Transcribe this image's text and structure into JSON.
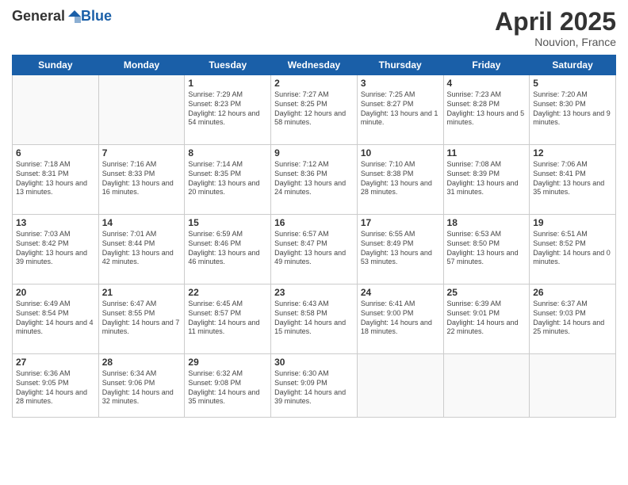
{
  "logo": {
    "general": "General",
    "blue": "Blue"
  },
  "header": {
    "title": "April 2025",
    "subtitle": "Nouvion, France"
  },
  "days": [
    "Sunday",
    "Monday",
    "Tuesday",
    "Wednesday",
    "Thursday",
    "Friday",
    "Saturday"
  ],
  "weeks": [
    [
      {
        "day": "",
        "info": ""
      },
      {
        "day": "",
        "info": ""
      },
      {
        "day": "1",
        "info": "Sunrise: 7:29 AM\nSunset: 8:23 PM\nDaylight: 12 hours and 54 minutes."
      },
      {
        "day": "2",
        "info": "Sunrise: 7:27 AM\nSunset: 8:25 PM\nDaylight: 12 hours and 58 minutes."
      },
      {
        "day": "3",
        "info": "Sunrise: 7:25 AM\nSunset: 8:27 PM\nDaylight: 13 hours and 1 minute."
      },
      {
        "day": "4",
        "info": "Sunrise: 7:23 AM\nSunset: 8:28 PM\nDaylight: 13 hours and 5 minutes."
      },
      {
        "day": "5",
        "info": "Sunrise: 7:20 AM\nSunset: 8:30 PM\nDaylight: 13 hours and 9 minutes."
      }
    ],
    [
      {
        "day": "6",
        "info": "Sunrise: 7:18 AM\nSunset: 8:31 PM\nDaylight: 13 hours and 13 minutes."
      },
      {
        "day": "7",
        "info": "Sunrise: 7:16 AM\nSunset: 8:33 PM\nDaylight: 13 hours and 16 minutes."
      },
      {
        "day": "8",
        "info": "Sunrise: 7:14 AM\nSunset: 8:35 PM\nDaylight: 13 hours and 20 minutes."
      },
      {
        "day": "9",
        "info": "Sunrise: 7:12 AM\nSunset: 8:36 PM\nDaylight: 13 hours and 24 minutes."
      },
      {
        "day": "10",
        "info": "Sunrise: 7:10 AM\nSunset: 8:38 PM\nDaylight: 13 hours and 28 minutes."
      },
      {
        "day": "11",
        "info": "Sunrise: 7:08 AM\nSunset: 8:39 PM\nDaylight: 13 hours and 31 minutes."
      },
      {
        "day": "12",
        "info": "Sunrise: 7:06 AM\nSunset: 8:41 PM\nDaylight: 13 hours and 35 minutes."
      }
    ],
    [
      {
        "day": "13",
        "info": "Sunrise: 7:03 AM\nSunset: 8:42 PM\nDaylight: 13 hours and 39 minutes."
      },
      {
        "day": "14",
        "info": "Sunrise: 7:01 AM\nSunset: 8:44 PM\nDaylight: 13 hours and 42 minutes."
      },
      {
        "day": "15",
        "info": "Sunrise: 6:59 AM\nSunset: 8:46 PM\nDaylight: 13 hours and 46 minutes."
      },
      {
        "day": "16",
        "info": "Sunrise: 6:57 AM\nSunset: 8:47 PM\nDaylight: 13 hours and 49 minutes."
      },
      {
        "day": "17",
        "info": "Sunrise: 6:55 AM\nSunset: 8:49 PM\nDaylight: 13 hours and 53 minutes."
      },
      {
        "day": "18",
        "info": "Sunrise: 6:53 AM\nSunset: 8:50 PM\nDaylight: 13 hours and 57 minutes."
      },
      {
        "day": "19",
        "info": "Sunrise: 6:51 AM\nSunset: 8:52 PM\nDaylight: 14 hours and 0 minutes."
      }
    ],
    [
      {
        "day": "20",
        "info": "Sunrise: 6:49 AM\nSunset: 8:54 PM\nDaylight: 14 hours and 4 minutes."
      },
      {
        "day": "21",
        "info": "Sunrise: 6:47 AM\nSunset: 8:55 PM\nDaylight: 14 hours and 7 minutes."
      },
      {
        "day": "22",
        "info": "Sunrise: 6:45 AM\nSunset: 8:57 PM\nDaylight: 14 hours and 11 minutes."
      },
      {
        "day": "23",
        "info": "Sunrise: 6:43 AM\nSunset: 8:58 PM\nDaylight: 14 hours and 15 minutes."
      },
      {
        "day": "24",
        "info": "Sunrise: 6:41 AM\nSunset: 9:00 PM\nDaylight: 14 hours and 18 minutes."
      },
      {
        "day": "25",
        "info": "Sunrise: 6:39 AM\nSunset: 9:01 PM\nDaylight: 14 hours and 22 minutes."
      },
      {
        "day": "26",
        "info": "Sunrise: 6:37 AM\nSunset: 9:03 PM\nDaylight: 14 hours and 25 minutes."
      }
    ],
    [
      {
        "day": "27",
        "info": "Sunrise: 6:36 AM\nSunset: 9:05 PM\nDaylight: 14 hours and 28 minutes."
      },
      {
        "day": "28",
        "info": "Sunrise: 6:34 AM\nSunset: 9:06 PM\nDaylight: 14 hours and 32 minutes."
      },
      {
        "day": "29",
        "info": "Sunrise: 6:32 AM\nSunset: 9:08 PM\nDaylight: 14 hours and 35 minutes."
      },
      {
        "day": "30",
        "info": "Sunrise: 6:30 AM\nSunset: 9:09 PM\nDaylight: 14 hours and 39 minutes."
      },
      {
        "day": "",
        "info": ""
      },
      {
        "day": "",
        "info": ""
      },
      {
        "day": "",
        "info": ""
      }
    ]
  ]
}
